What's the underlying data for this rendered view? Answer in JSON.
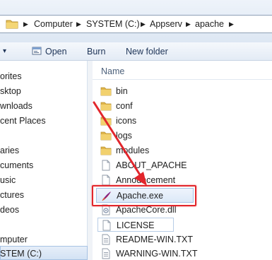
{
  "address": {
    "crumbs": [
      "Computer",
      "SYSTEM (C:)",
      "Appserv",
      "apache"
    ]
  },
  "toolbar": {
    "open_label": "Open",
    "burn_label": "Burn",
    "new_folder_label": "New folder"
  },
  "nav": {
    "items": [
      "orites",
      "sktop",
      "wnloads",
      "cent Places",
      "aries",
      "cuments",
      "usic",
      "ctures",
      "deos",
      "mputer",
      "STEM (C:)"
    ]
  },
  "list": {
    "column_name": "Name",
    "files": [
      {
        "name": "bin",
        "icon": "folder-icon"
      },
      {
        "name": "conf",
        "icon": "folder-icon"
      },
      {
        "name": "icons",
        "icon": "folder-icon"
      },
      {
        "name": "logs",
        "icon": "folder-icon"
      },
      {
        "name": "modules",
        "icon": "folder-icon"
      },
      {
        "name": "ABOUT_APACHE",
        "icon": "document-icon"
      },
      {
        "name": "Announcement",
        "icon": "document-icon"
      },
      {
        "name": "Apache.exe",
        "icon": "apache-feather-icon"
      },
      {
        "name": "ApacheCore.dll",
        "icon": "dll-icon"
      },
      {
        "name": "LICENSE",
        "icon": "document-icon"
      },
      {
        "name": "README-WIN.TXT",
        "icon": "text-document-icon"
      },
      {
        "name": "WARNING-WIN.TXT",
        "icon": "text-document-icon"
      }
    ]
  },
  "colors": {
    "annotation_red": "#e2262c",
    "selection_blue": "#dce9f8"
  }
}
